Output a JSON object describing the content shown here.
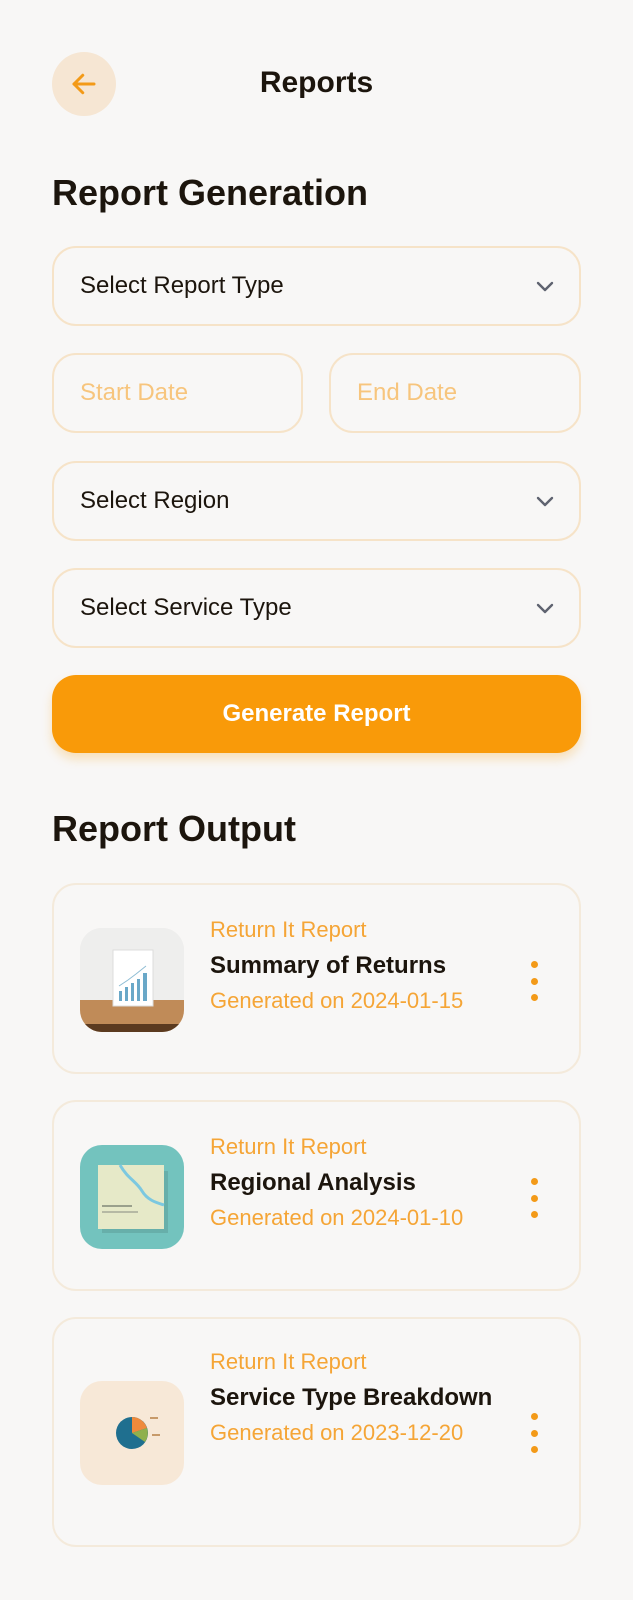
{
  "header": {
    "title": "Reports",
    "back_icon": "arrow-left-icon"
  },
  "generation": {
    "title": "Report Generation",
    "report_type": {
      "value": "Select Report Type"
    },
    "start_date": {
      "placeholder": "Start Date"
    },
    "end_date": {
      "placeholder": "End Date"
    },
    "region": {
      "value": "Select Region"
    },
    "service_type": {
      "value": "Select Service Type"
    },
    "generate_label": "Generate Report"
  },
  "output": {
    "title": "Report Output",
    "reports": [
      {
        "kicker": "Return It Report",
        "title": "Summary of Returns",
        "date": "Generated on 2024-01-15",
        "thumb": "bar-chart-thumbnail"
      },
      {
        "kicker": "Return It Report",
        "title": "Regional Analysis",
        "date": "Generated on 2024-01-10",
        "thumb": "map-thumbnail"
      },
      {
        "kicker": "Return It Report",
        "title": "Service Type Breakdown",
        "date": "Generated on 2023-12-20",
        "thumb": "pie-chart-thumbnail"
      }
    ]
  },
  "colors": {
    "accent": "#f99a09",
    "accent_soft": "#f6e6d3",
    "text": "#1c150d",
    "muted_accent": "#f5a536",
    "border": "#f6e3c8"
  }
}
